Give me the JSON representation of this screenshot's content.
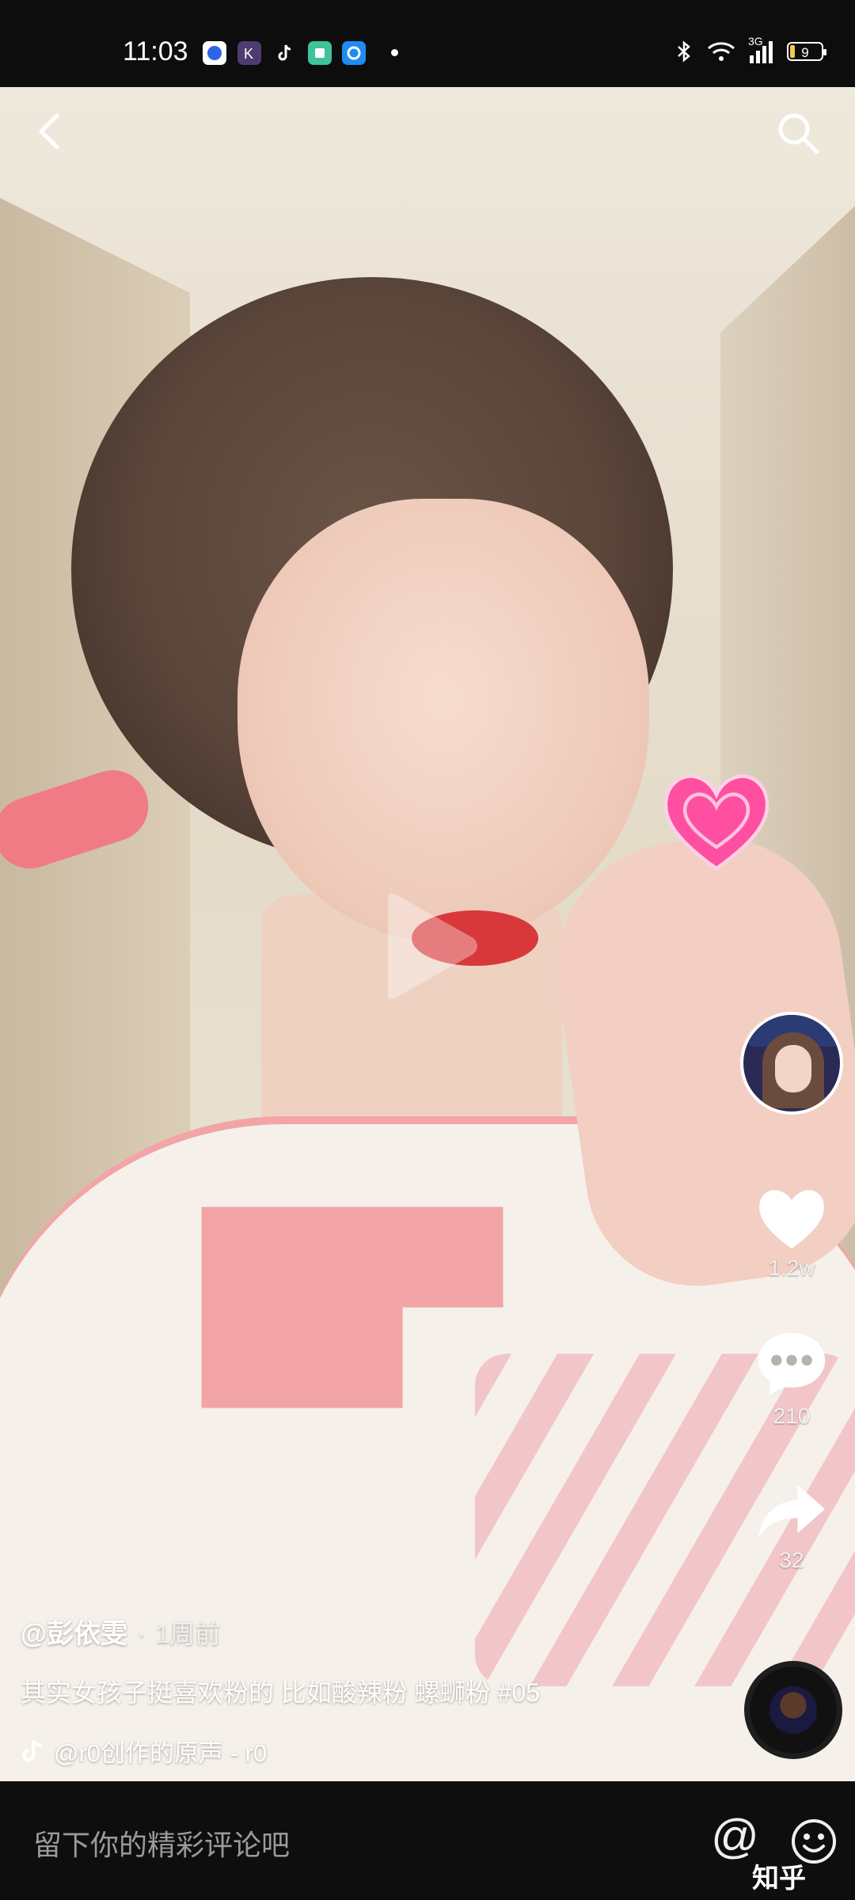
{
  "status_bar": {
    "time": "11:03",
    "apps": [
      "baidu-app-icon",
      "kuaishou-app-icon",
      "tiktok-app-icon",
      "wechat-app-icon",
      "qq-browser-app-icon"
    ],
    "battery": "9",
    "network": "3G"
  },
  "video": {
    "author": "@彭依雯",
    "separator": "·",
    "time_ago": "1周前",
    "caption": "其实女孩子挺喜欢粉的 比如酸辣粉 螺蛳粉 #05",
    "music": "@r0创作的原声 - r0"
  },
  "actions": {
    "likes": "1.2w",
    "comments": "210",
    "shares": "32"
  },
  "comment_bar": {
    "placeholder": "留下你的精彩评论吧",
    "at": "@",
    "watermark": "知乎"
  },
  "colors": {
    "heart": "#ff4fa0",
    "bar_bg": "#0e0e0e"
  }
}
